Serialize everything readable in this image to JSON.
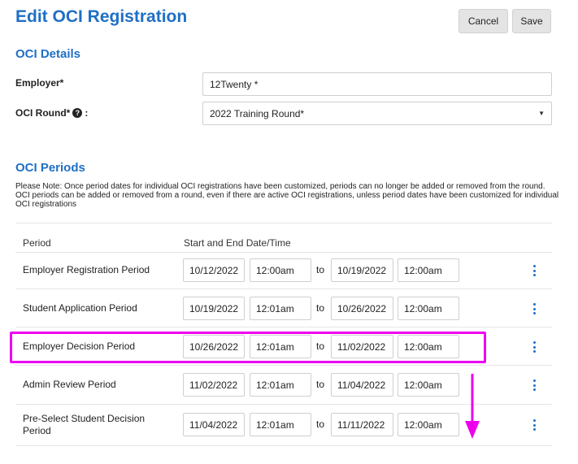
{
  "header": {
    "title": "Edit OCI Registration",
    "cancel_label": "Cancel",
    "save_label": "Save"
  },
  "details": {
    "section_title": "OCI Details",
    "employer_label": "Employer*",
    "employer_value": "12Twenty *",
    "round_label": "OCI Round*",
    "round_suffix": ":",
    "round_value": "2022 Training Round*"
  },
  "periods": {
    "section_title": "OCI Periods",
    "note": "Please Note: Once period dates for individual OCI registrations have been customized, periods can no longer be added or removed from the round. OCI periods can be added or removed from a round, even if there are active OCI registrations, unless period dates have been customized for individual OCI registrations",
    "col_period": "Period",
    "col_dates": "Start and End Date/Time",
    "to_label": "to",
    "rows": [
      {
        "name": "Employer Registration Period",
        "start_date": "10/12/2022",
        "start_time": "12:00am",
        "end_date": "10/19/2022",
        "end_time": "12:00am"
      },
      {
        "name": "Student Application Period",
        "start_date": "10/19/2022",
        "start_time": "12:01am",
        "end_date": "10/26/2022",
        "end_time": "12:00am"
      },
      {
        "name": "Employer Decision Period",
        "start_date": "10/26/2022",
        "start_time": "12:01am",
        "end_date": "11/02/2022",
        "end_time": "12:00am"
      },
      {
        "name": "Admin Review Period",
        "start_date": "11/02/2022",
        "start_time": "12:01am",
        "end_date": "11/04/2022",
        "end_time": "12:00am"
      },
      {
        "name": "Pre-Select Student Decision Period",
        "start_date": "11/04/2022",
        "start_time": "12:01am",
        "end_date": "11/11/2022",
        "end_time": "12:00am"
      }
    ]
  },
  "icons": {
    "help": "question-circle-icon",
    "dropdown": "caret-down-icon",
    "row_menu": "vertical-ellipsis-icon"
  },
  "colors": {
    "accent": "#1f6fc5",
    "annotation": "#ee00ee"
  }
}
